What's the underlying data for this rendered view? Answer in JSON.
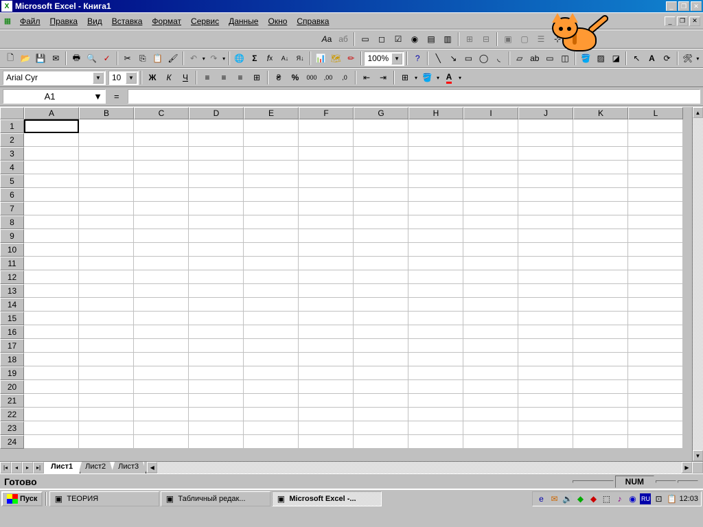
{
  "window": {
    "app_name": "Microsoft Excel",
    "doc_name": "Книга1",
    "title": "Microsoft Excel - Книга1"
  },
  "menu": [
    "Файл",
    "Правка",
    "Вид",
    "Вставка",
    "Формат",
    "Сервис",
    "Данные",
    "Окно",
    "Справка"
  ],
  "formatting": {
    "font_name": "Arial Cyr",
    "font_size": "10",
    "zoom": "100%",
    "bold": "Ж",
    "italic": "К",
    "underline": "Ч",
    "percent": "%",
    "currency": "₴",
    "comma": "000",
    "sigma": "Σ",
    "fx": "f",
    "fx_sub": "x"
  },
  "cell_ref": {
    "active": "A1",
    "eq": "="
  },
  "columns": [
    "A",
    "B",
    "C",
    "D",
    "E",
    "F",
    "G",
    "H",
    "I",
    "J",
    "K",
    "L"
  ],
  "rows": [
    "1",
    "2",
    "3",
    "4",
    "5",
    "6",
    "7",
    "8",
    "9",
    "10",
    "11",
    "12",
    "13",
    "14",
    "15",
    "16",
    "17",
    "18",
    "19",
    "20",
    "21",
    "22",
    "23",
    "24"
  ],
  "sheets": {
    "tabs": [
      "Лист1",
      "Лист2",
      "Лист3"
    ],
    "active": 0
  },
  "status": {
    "ready": "Готово",
    "indicator": "NUM"
  },
  "taskbar": {
    "start": "Пуск",
    "items": [
      {
        "label": "ТЕОРИЯ",
        "active": false
      },
      {
        "label": "Табличный редак...",
        "active": false
      },
      {
        "label": "Microsoft Excel -...",
        "active": true
      }
    ],
    "clock": "12:03",
    "lang": "RU"
  }
}
